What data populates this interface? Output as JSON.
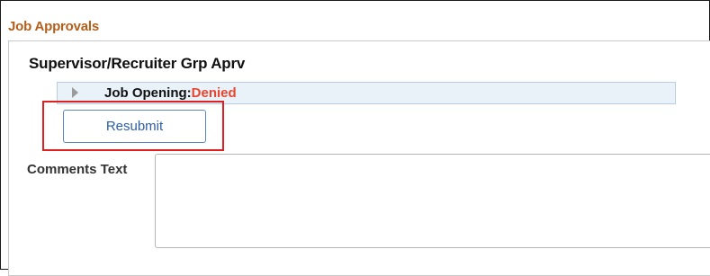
{
  "section": {
    "title": "Job Approvals"
  },
  "stage": {
    "heading": "Supervisor/Recruiter Grp Aprv"
  },
  "status": {
    "label": "Job Opening:",
    "value": "Denied",
    "value_color": "#e8442e",
    "expand_icon": "triangle-right-icon"
  },
  "actions": {
    "resubmit_label": "Resubmit"
  },
  "comments": {
    "label": "Comments Text",
    "value": "",
    "placeholder": ""
  },
  "colors": {
    "section_title": "#b35f1b",
    "status_bar_bg": "#e9f1f9",
    "button_text": "#2c5fa8",
    "highlight": "#e02020"
  }
}
